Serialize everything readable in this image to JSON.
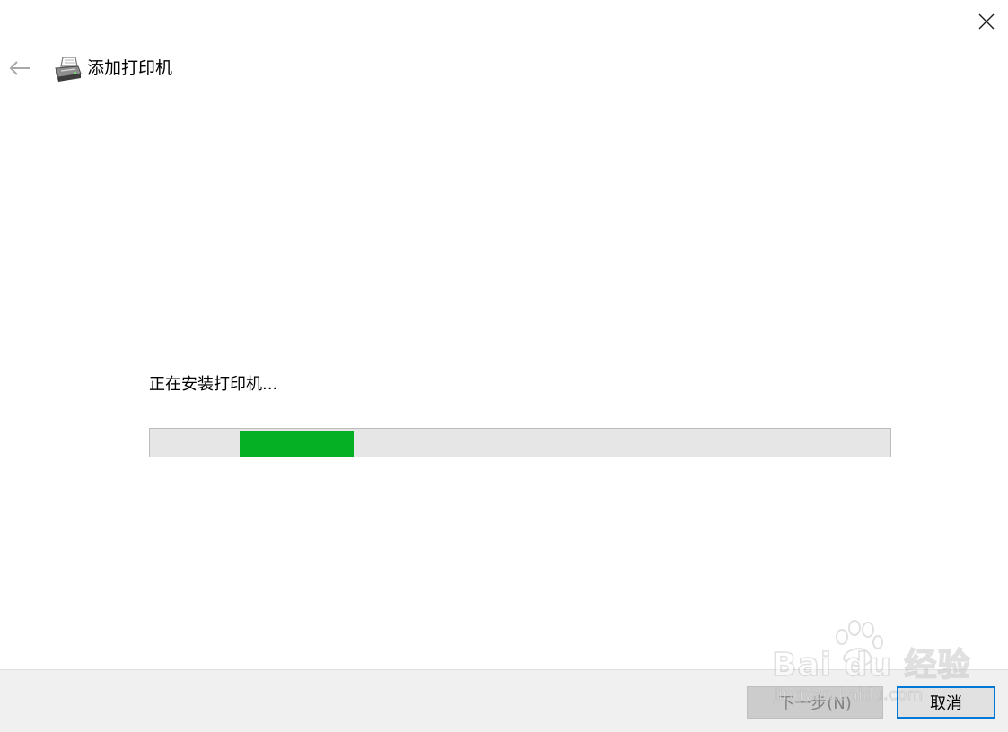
{
  "window": {
    "close_icon": "close-icon"
  },
  "header": {
    "back_icon": "back-arrow-icon",
    "app_icon": "printer-icon",
    "title": "添加打印机"
  },
  "main": {
    "status_text": "正在安装打印机...",
    "progress": {
      "type": "indeterminate",
      "fill_color": "#06b025",
      "track_color": "#e6e6e6"
    }
  },
  "footer": {
    "next_button_label": "下一步(N)",
    "next_button_enabled": false,
    "cancel_button_label": "取消"
  },
  "watermark": {
    "brand": "Bai du 经验",
    "url": "jingyan.baidu.com"
  },
  "colors": {
    "accent": "#0078d7",
    "progress": "#06b025",
    "footer_bg": "#f0f0f0"
  }
}
